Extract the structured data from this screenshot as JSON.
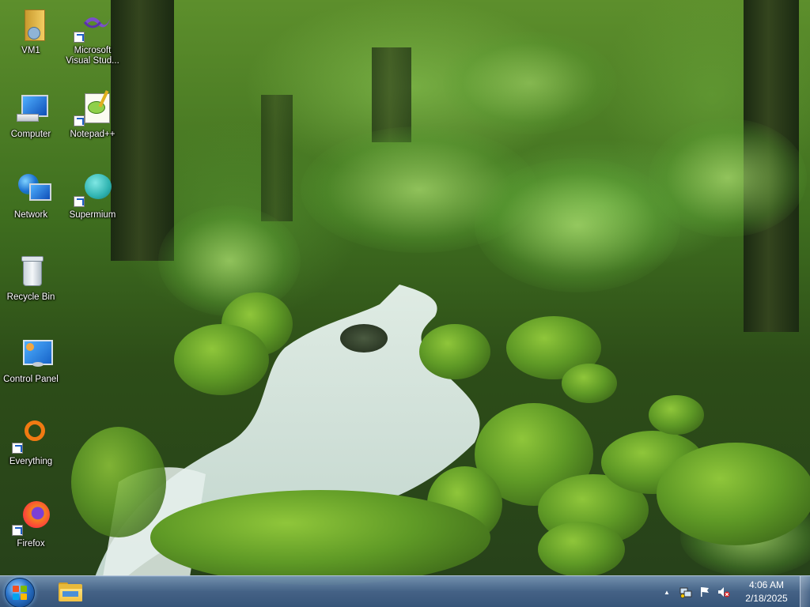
{
  "desktop": {
    "icons": [
      {
        "label": "VM1",
        "icon": "folder-user-icon"
      },
      {
        "label": "Microsoft Visual Stud...",
        "icon": "visual-studio-icon"
      },
      {
        "label": "Computer",
        "icon": "computer-icon"
      },
      {
        "label": "Notepad++",
        "icon": "notepadpp-icon"
      },
      {
        "label": "Network",
        "icon": "network-icon"
      },
      {
        "label": "Supermium",
        "icon": "supermium-icon"
      },
      {
        "label": "Recycle Bin",
        "icon": "recycle-bin-icon"
      },
      {
        "label": "Control Panel",
        "icon": "control-panel-icon"
      },
      {
        "label": "Everything",
        "icon": "everything-search-icon"
      },
      {
        "label": "Firefox",
        "icon": "firefox-icon"
      }
    ]
  },
  "taskbar": {
    "pinned": [
      {
        "name": "Windows Explorer",
        "icon": "file-explorer-icon"
      }
    ],
    "tray": {
      "show_hidden": "▲",
      "time": "4:06 AM",
      "date": "2/18/2025"
    }
  },
  "colors": {
    "taskbar": "#4a6a95",
    "start_orb": "#2a73c9",
    "label_text": "#ffffff"
  }
}
